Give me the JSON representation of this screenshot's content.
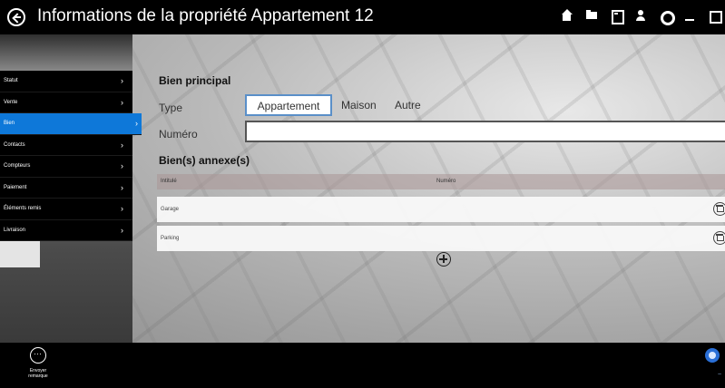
{
  "window": {
    "title": "Informations de la propriété Appartement 12",
    "titlebar_icons": [
      "home-icon",
      "folder-icon",
      "calculator-icon",
      "user-icon",
      "gear-icon",
      "minimize-icon",
      "maximize-icon"
    ]
  },
  "sidebar": {
    "items": [
      {
        "label": "Statut"
      },
      {
        "label": "Vente"
      },
      {
        "label": "Bien"
      },
      {
        "label": "Contacts"
      },
      {
        "label": "Compteurs"
      },
      {
        "label": "Paiement"
      },
      {
        "label": "Éléments remis"
      },
      {
        "label": "Livraison"
      }
    ],
    "active_index": 2,
    "active_color": "#0e78d9"
  },
  "main": {
    "bien_principal_title": "Bien principal",
    "type_label": "Type",
    "type_options": [
      "Appartement",
      "Maison",
      "Autre"
    ],
    "type_selected": "Appartement",
    "numero_label": "Numéro",
    "numero_value": "",
    "annexes_title": "Bien(s) annexe(s)",
    "table": {
      "headers": [
        "Intitulé",
        "Numéro"
      ],
      "rows": [
        {
          "intitule": "Garage",
          "numero": ""
        },
        {
          "intitule": "Parking",
          "numero": ""
        }
      ]
    }
  },
  "bottombar": {
    "left_button_label": "Envoyer remarque"
  }
}
